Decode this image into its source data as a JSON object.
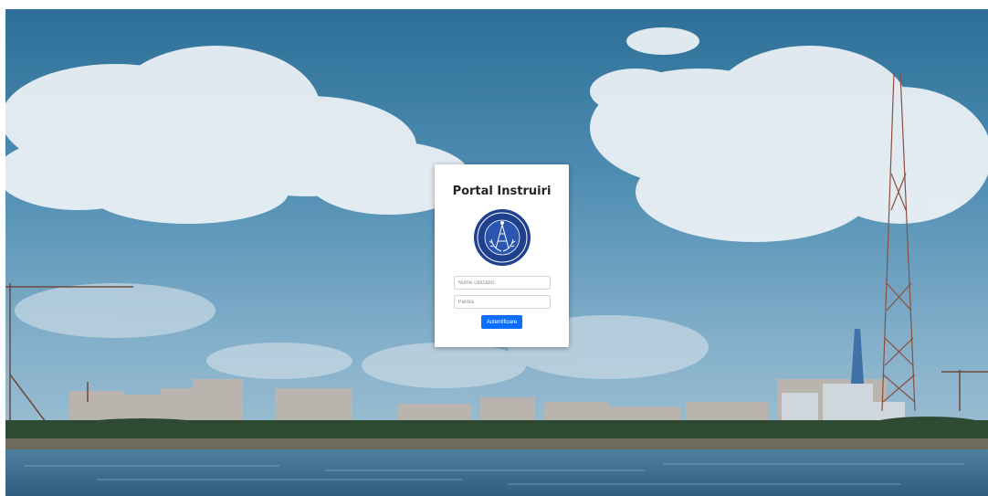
{
  "login": {
    "title": "Portal Instruiri",
    "username_placeholder": "Nume utilizator",
    "password_placeholder": "Parolă",
    "submit_label": "Autentificare"
  },
  "colors": {
    "primary_button": "#0d6efd",
    "logo_blue": "#1f3f8f",
    "card_background": "#ffffff"
  },
  "icons": {
    "logo": "university-seal-logo"
  }
}
